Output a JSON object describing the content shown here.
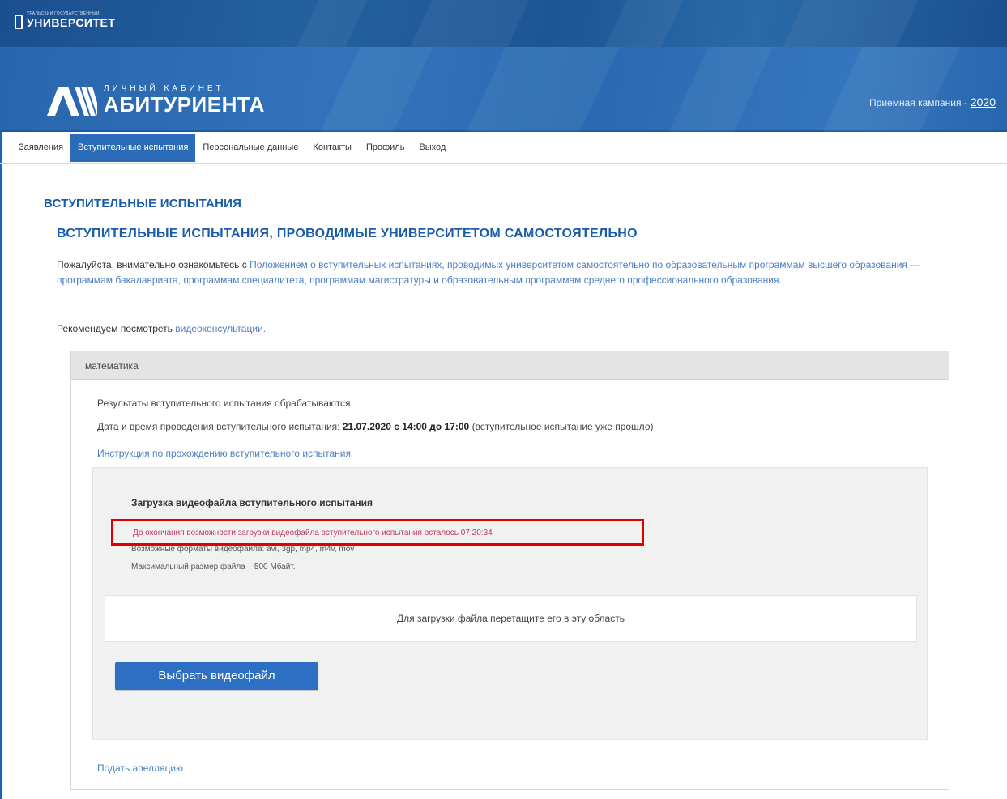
{
  "university": {
    "small": "Уральский государственный",
    "name": "УНИВЕРСИТЕТ"
  },
  "brand": {
    "small": "ЛИЧНЫЙ КАБИНЕТ",
    "big": "АБИТУРИЕНТА"
  },
  "campaign": {
    "label": "Приемная кампания -",
    "year": "2020"
  },
  "nav": {
    "items": [
      {
        "label": "Заявления"
      },
      {
        "label": "Вступительные испытания"
      },
      {
        "label": "Персональные данные"
      },
      {
        "label": "Контакты"
      },
      {
        "label": "Профиль"
      },
      {
        "label": "Выход"
      }
    ]
  },
  "page": {
    "title": "ВСТУПИТЕЛЬНЫЕ ИСПЫТАНИЯ",
    "subtitle": "ВСТУПИТЕЛЬНЫЕ ИСПЫТАНИЯ, ПРОВОДИМЫЕ УНИВЕРСИТЕТОМ САМОСТОЯТЕЛЬНО",
    "intro_prefix": "Пожалуйста, внимательно ознакомьтесь с ",
    "intro_link": "Положением о вступительных испытаниях, проводимых университетом самостоятельно по образовательным программам высшего образования — программам бакалавриата, программам специалитета, программам магистратуры и образовательным программам среднего профессионального образования.",
    "recommend_prefix": "Рекомендуем посмотреть ",
    "recommend_link": "видеоконсультации."
  },
  "exam": {
    "subject": "математика",
    "status": "Результаты вступительного испытания обрабатываются",
    "datetime_prefix": "Дата и время проведения вступительного испытания: ",
    "datetime_value": "21.07.2020 с 14:00 до 17:00",
    "datetime_suffix": " (вступительное испытание уже прошло)",
    "instruction_link": "Инструкция по прохождению вступительного испытания",
    "appeal_link": "Подать апелляцию"
  },
  "upload": {
    "title": "Загрузка видеофайла вступительного испытания",
    "countdown": "До окончания возможности загрузки видеофайла вступительного испытания осталось 07:20:34",
    "formats": "Возможные форматы видеофайла: avi, 3gp, mp4, m4v, mov",
    "max_size": "Максимальный размер файла – 500 Мбайт.",
    "dropzone": "Для загрузки файла перетащите его в эту область",
    "button": "Выбрать видеофайл"
  },
  "colors": {
    "brand_blue": "#2a6cb8",
    "link": "#4b7fc0",
    "heading": "#1a5ca8",
    "highlight": "#e00000",
    "countdown_text": "#c0395a"
  }
}
